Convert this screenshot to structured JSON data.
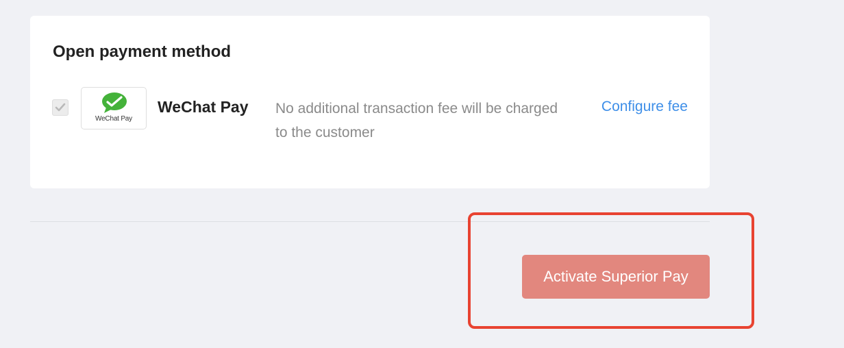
{
  "card": {
    "title": "Open payment method",
    "methods": [
      {
        "checked": true,
        "logo_icon": "wechat-pay-icon",
        "logo_caption": "WeChat Pay",
        "name": "WeChat Pay",
        "description": "No additional transaction fee will be charged to the customer",
        "action_label": "Configure fee"
      }
    ]
  },
  "footer": {
    "activate_label": "Activate Superior Pay"
  },
  "colors": {
    "page_background": "#f0f1f5",
    "card_background": "#ffffff",
    "link": "#3d8ee8",
    "button_background": "#e2877e",
    "highlight_border": "#e84331",
    "wechat_green": "#44b23a"
  }
}
